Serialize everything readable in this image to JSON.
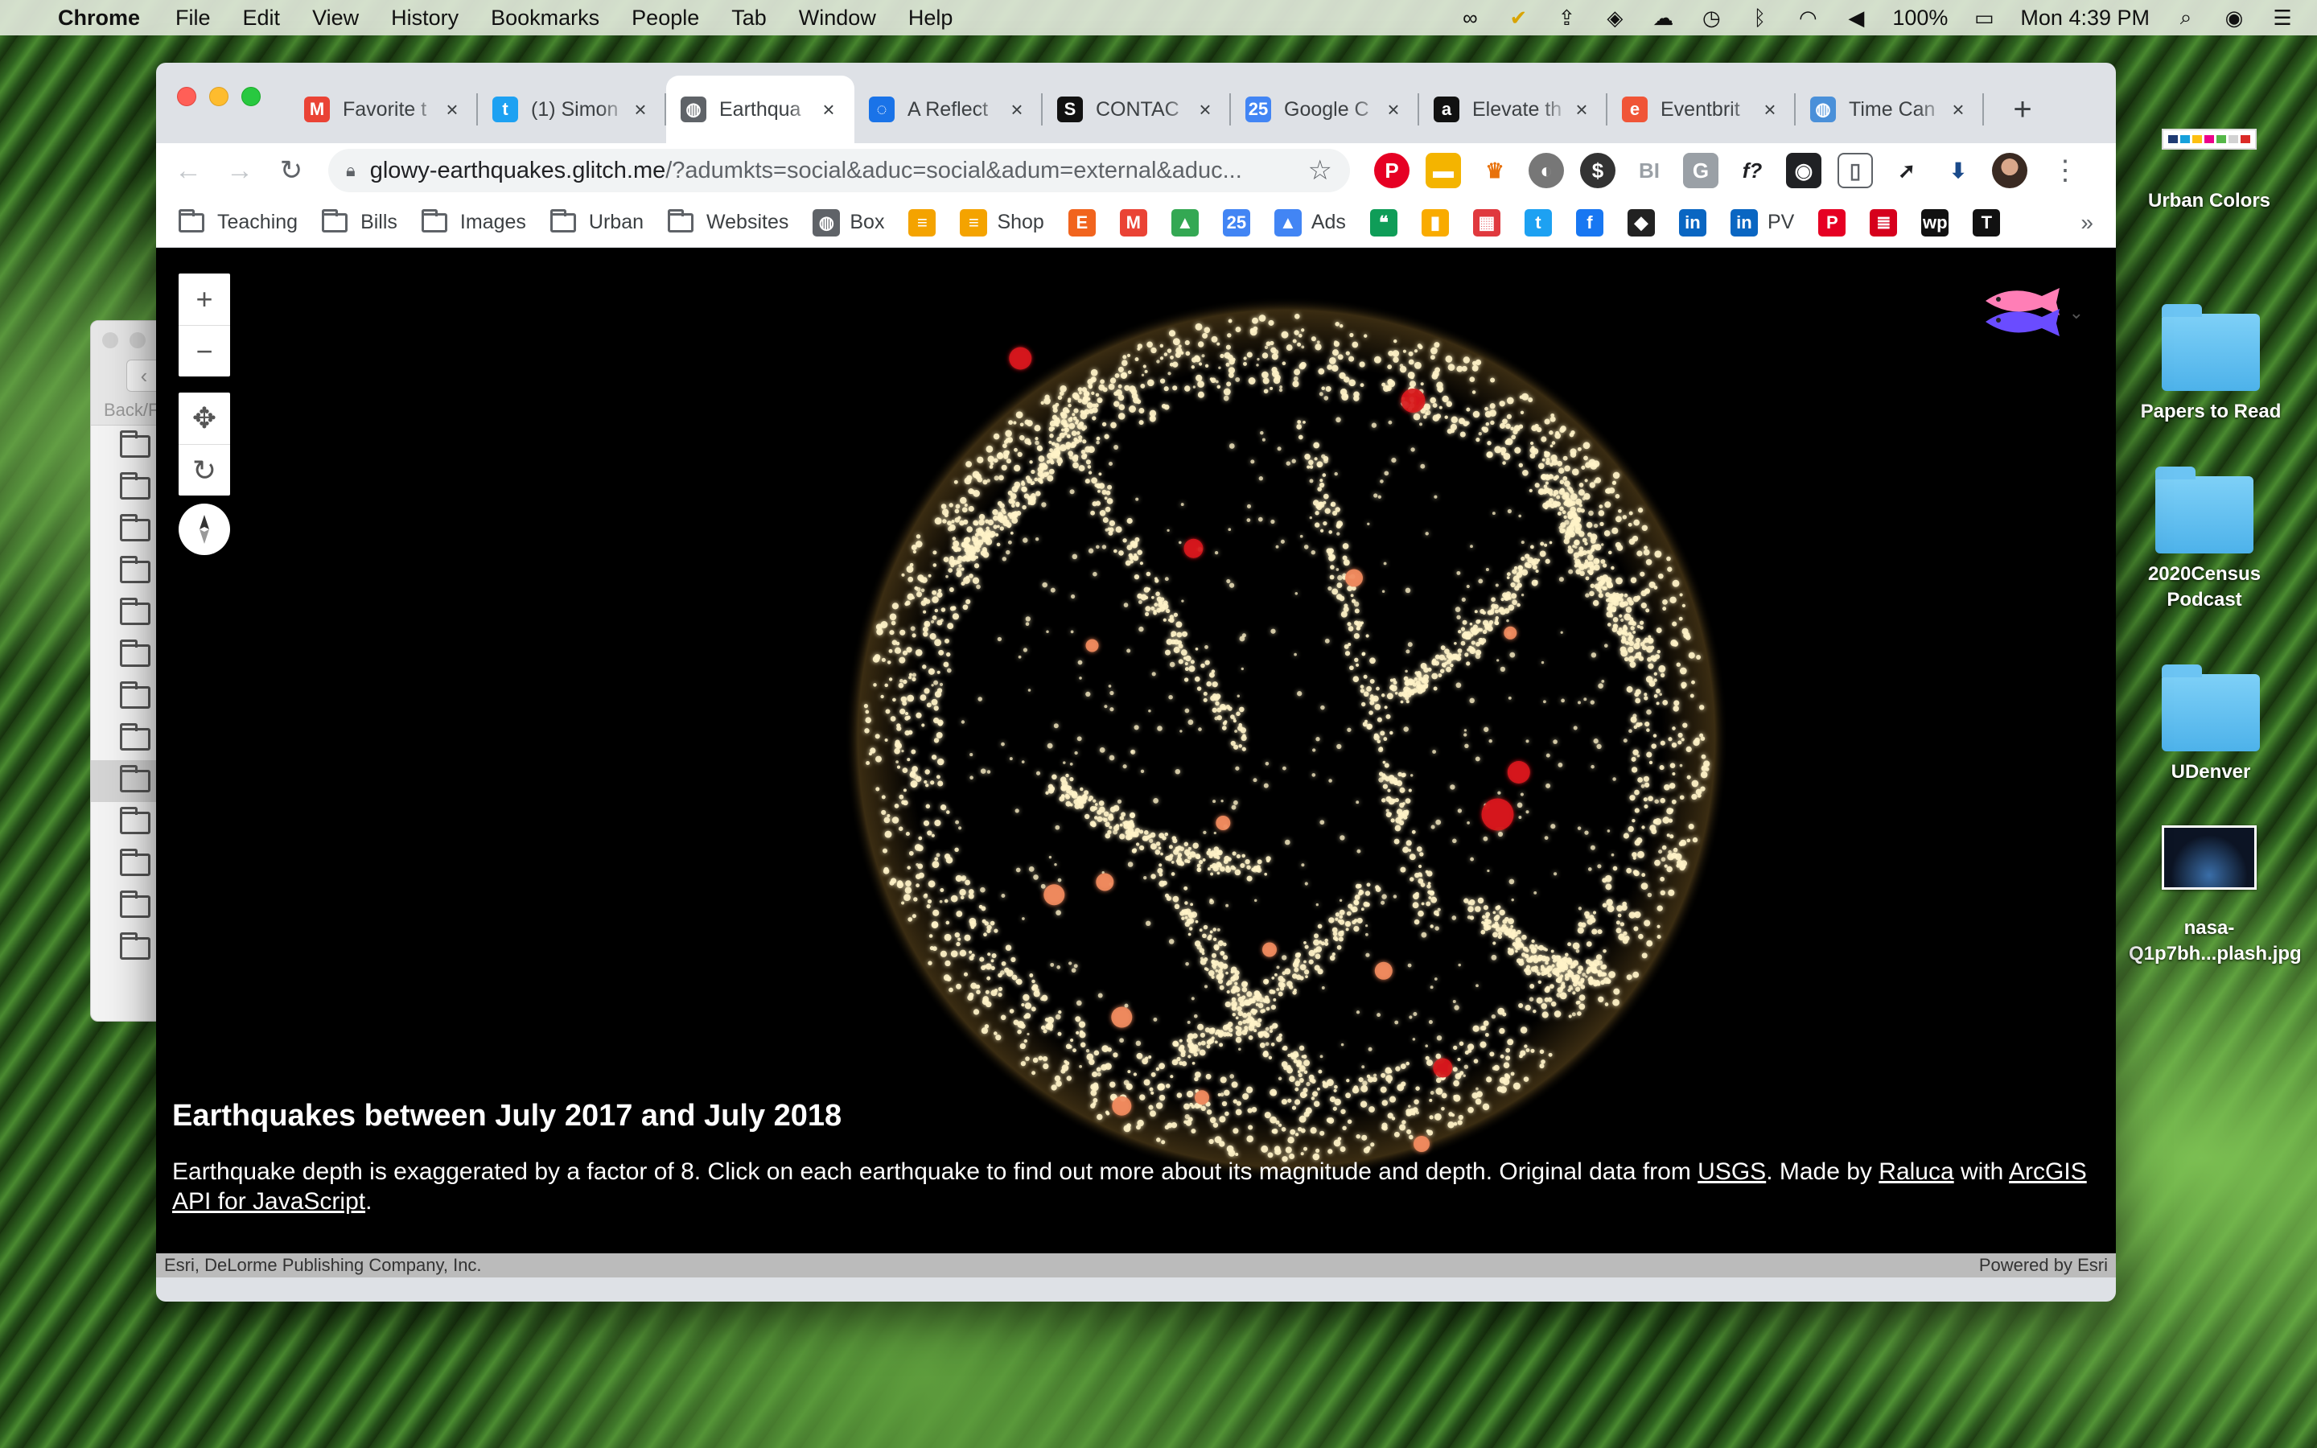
{
  "menubar": {
    "app": "Chrome",
    "items": [
      "File",
      "Edit",
      "View",
      "History",
      "Bookmarks",
      "People",
      "Tab",
      "Window",
      "Help"
    ],
    "battery": "100%",
    "clock": "Mon 4:39 PM",
    "status_icons": [
      "creative-cloud-icon",
      "norton-check-icon",
      "upload-icon",
      "dropbox-icon",
      "cloud-icon",
      "time-machine-icon",
      "bluetooth-icon",
      "wifi-icon",
      "volume-icon"
    ]
  },
  "finder": {
    "back_label": "Back/F"
  },
  "tabs": [
    {
      "title": "Favorite t",
      "favicon": "gmail-icon",
      "color": "#ea4335",
      "glyph": "M"
    },
    {
      "title": "(1) Simon",
      "favicon": "twitter-icon",
      "color": "#1da1f2",
      "glyph": "t"
    },
    {
      "title": "Earthqua",
      "favicon": "globe-icon",
      "color": "#5f6368",
      "glyph": "◍",
      "active": true
    },
    {
      "title": "A Reflect",
      "favicon": "loading-icon",
      "color": "#1a73e8",
      "glyph": "◌"
    },
    {
      "title": "CONTAC",
      "favicon": "scribd-icon",
      "color": "#111111",
      "glyph": "S"
    },
    {
      "title": "Google C",
      "favicon": "google-calendar-icon",
      "color": "#4285f4",
      "glyph": "25"
    },
    {
      "title": "Elevate th",
      "favicon": "amazon-icon",
      "color": "#111111",
      "glyph": "a"
    },
    {
      "title": "Eventbrit",
      "favicon": "eventbrite-icon",
      "color": "#f05537",
      "glyph": "e"
    },
    {
      "title": "Time Can",
      "favicon": "globe-color-icon",
      "color": "#4a90d9",
      "glyph": "◍"
    }
  ],
  "toolbar": {
    "url_host": "glowy-earthquakes.glitch.me",
    "url_rest": "/?adumkts=social&aduc=social&adum=external&aduc..."
  },
  "bookmarks": [
    {
      "label": "Teaching",
      "type": "folder"
    },
    {
      "label": "Bills",
      "type": "folder"
    },
    {
      "label": "Images",
      "type": "folder"
    },
    {
      "label": "Urban",
      "type": "folder"
    },
    {
      "label": "Websites",
      "type": "folder"
    },
    {
      "label": "Box",
      "type": "site",
      "icon": "globe-icon",
      "color": "#5f6368",
      "glyph": "◍"
    },
    {
      "label": "",
      "type": "site",
      "icon": "list-icon",
      "color": "#f4a300",
      "glyph": "≡"
    },
    {
      "label": "Shop",
      "type": "site",
      "icon": "list-icon",
      "color": "#f4a300",
      "glyph": "≡"
    },
    {
      "label": "",
      "type": "site",
      "icon": "etsy-icon",
      "color": "#f1641e",
      "glyph": "E"
    },
    {
      "label": "",
      "type": "site",
      "icon": "gmail-icon",
      "color": "#ea4335",
      "glyph": "M"
    },
    {
      "label": "",
      "type": "site",
      "icon": "google-drive-icon",
      "color": "#34a853",
      "glyph": "▲"
    },
    {
      "label": "",
      "type": "site",
      "icon": "google-calendar-icon",
      "color": "#4285f4",
      "glyph": "25"
    },
    {
      "label": "Ads",
      "type": "site",
      "icon": "google-ads-icon",
      "color": "#4285f4",
      "glyph": "▲"
    },
    {
      "label": "",
      "type": "site",
      "icon": "hangouts-icon",
      "color": "#0f9d58",
      "glyph": "❝"
    },
    {
      "label": "",
      "type": "site",
      "icon": "analytics-icon",
      "color": "#f9ab00",
      "glyph": "▮"
    },
    {
      "label": "",
      "type": "site",
      "icon": "meetup-icon",
      "color": "#e0393e",
      "glyph": "▦"
    },
    {
      "label": "",
      "type": "site",
      "icon": "twitter-icon",
      "color": "#1da1f2",
      "glyph": "t"
    },
    {
      "label": "",
      "type": "site",
      "icon": "facebook-icon",
      "color": "#1877f2",
      "glyph": "f"
    },
    {
      "label": "",
      "type": "site",
      "icon": "bird-icon",
      "color": "#222222",
      "glyph": "◆"
    },
    {
      "label": "",
      "type": "site",
      "icon": "linkedin-icon",
      "color": "#0a66c2",
      "glyph": "in"
    },
    {
      "label": "PV",
      "type": "site",
      "icon": "linkedin-icon",
      "color": "#0a66c2",
      "glyph": "in"
    },
    {
      "label": "",
      "type": "site",
      "icon": "pinterest-icon",
      "color": "#e60023",
      "glyph": "P"
    },
    {
      "label": "",
      "type": "site",
      "icon": "stack-icon",
      "color": "#d6001c",
      "glyph": "≣"
    },
    {
      "label": "",
      "type": "site",
      "icon": "washington-post-icon",
      "color": "#111111",
      "glyph": "wp"
    },
    {
      "label": "",
      "type": "site",
      "icon": "nytimes-icon",
      "color": "#111111",
      "glyph": "T"
    }
  ],
  "map": {
    "title": "Earthquakes between July 2017 and July 2018",
    "desc_1": "Earthquake depth is exaggerated by a factor of 8. Click on each earthquake to find out more about its magnitude and depth. Original data from ",
    "link_usgs": "USGS",
    "desc_2": ". Made by ",
    "link_author": "Raluca",
    "desc_3": " with ",
    "link_api": "ArcGIS API for JavaScript",
    "desc_4": ".",
    "attribution_left": "Esri, DeLorme Publishing Company, Inc.",
    "attribution_right": "Powered by Esri",
    "colors": {
      "quake_small": "#fff3c8",
      "quake_medium": "#f08a5d",
      "quake_large": "#d7191c"
    }
  },
  "desktop": [
    {
      "label": "Urban Colors",
      "kind": "swatch"
    },
    {
      "label": "Papers to Read",
      "kind": "folder"
    },
    {
      "label": "2020Census Podcast",
      "kind": "folder"
    },
    {
      "label": "UDenver",
      "kind": "folder"
    },
    {
      "label": "nasa-Q1p7bh...plash.jpg",
      "kind": "image"
    }
  ]
}
